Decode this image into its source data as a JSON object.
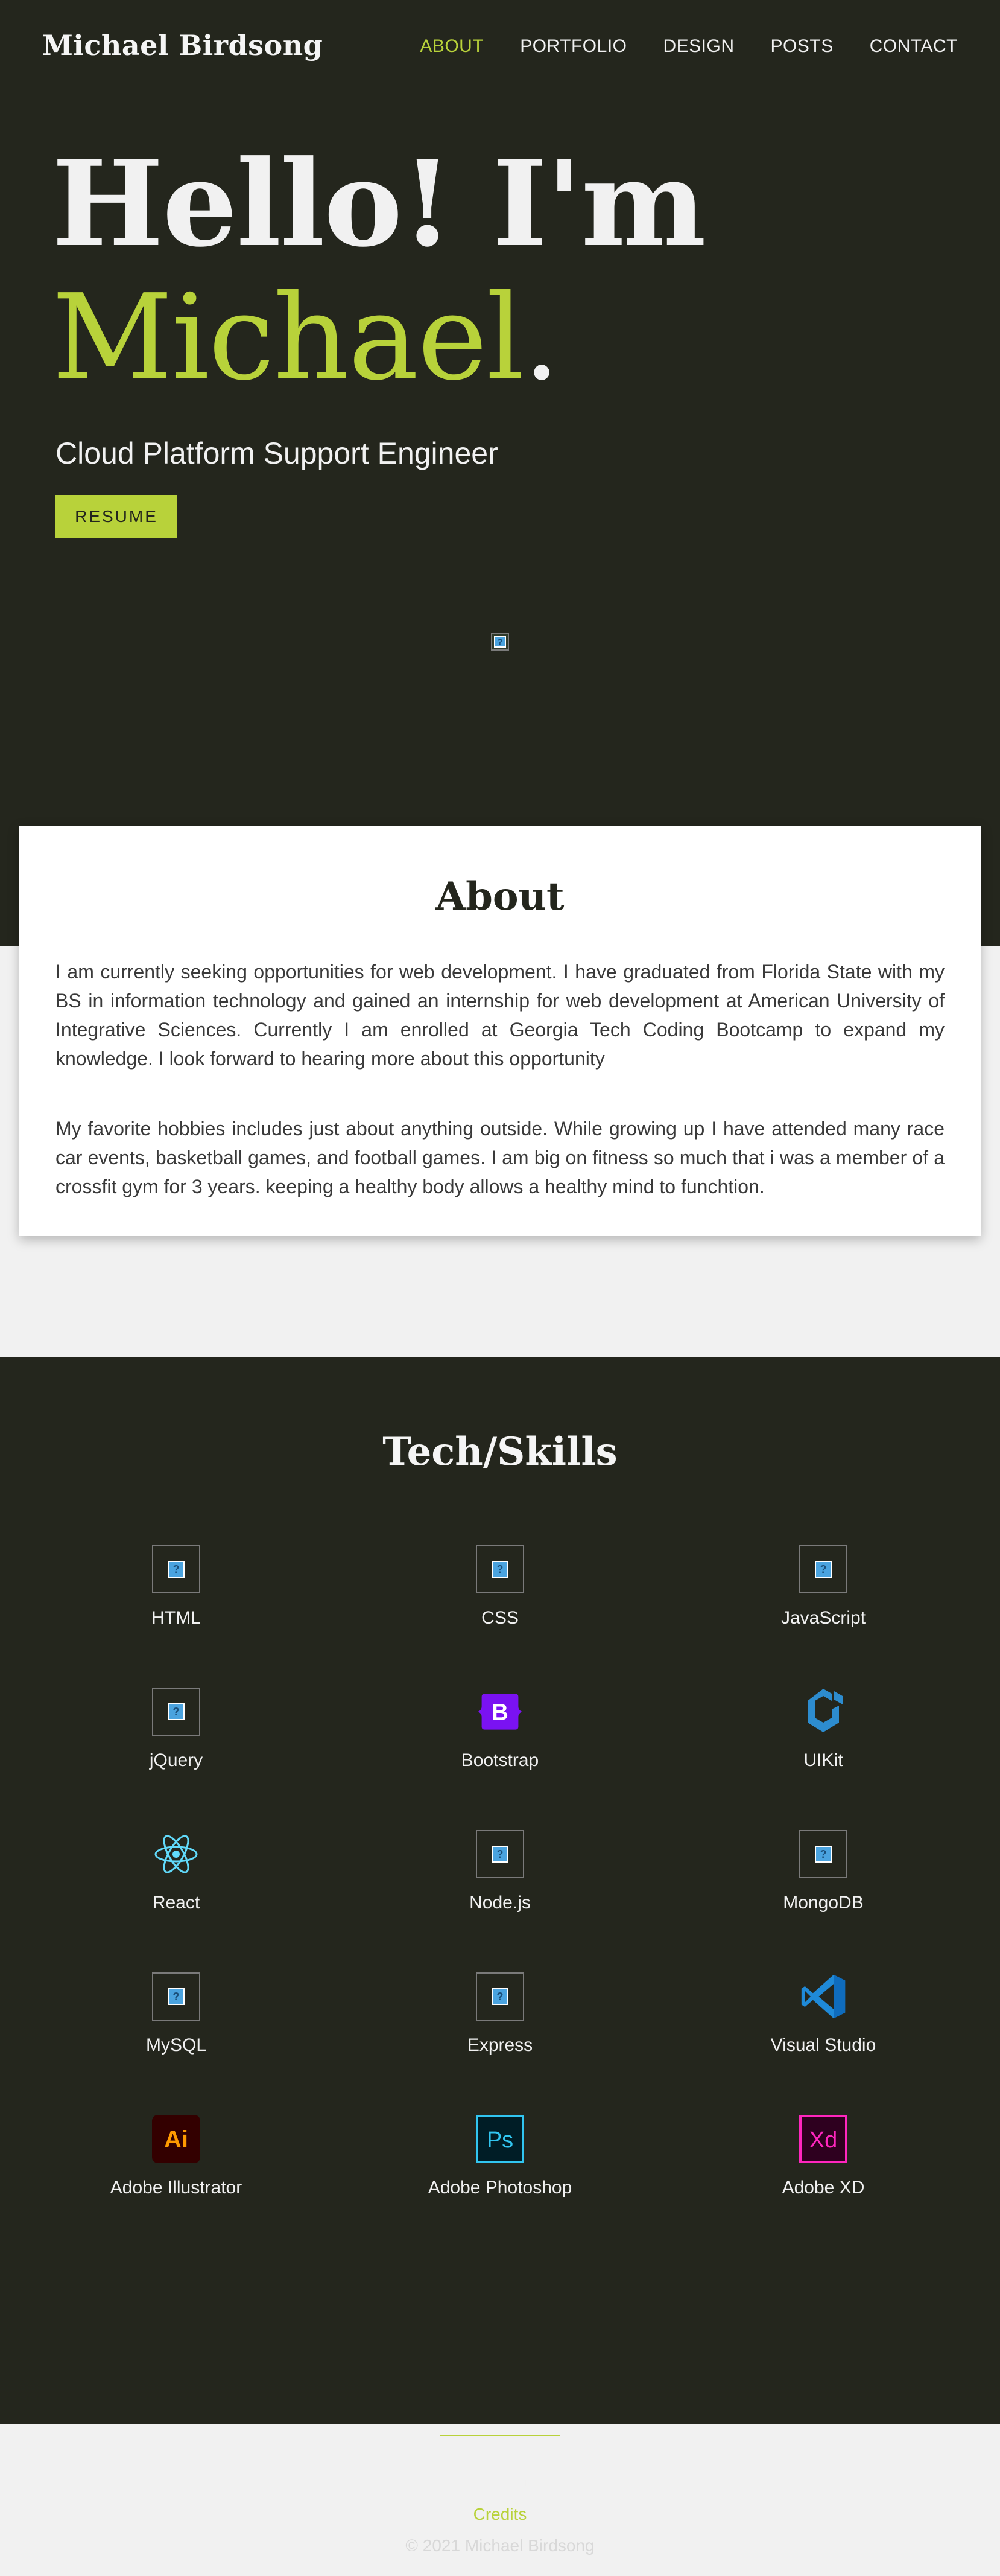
{
  "header": {
    "brand": "Michael Birdsong",
    "nav": [
      {
        "label": "ABOUT",
        "active": true
      },
      {
        "label": "PORTFOLIO",
        "active": false
      },
      {
        "label": "DESIGN",
        "active": false
      },
      {
        "label": "POSTS",
        "active": false
      },
      {
        "label": "CONTACT",
        "active": false
      }
    ]
  },
  "hero": {
    "line1": "Hello! I'm",
    "name": "Michael",
    "dot": ".",
    "subtitle": "Cloud Platform Support Engineer",
    "resume_label": "RESUME"
  },
  "about": {
    "title": "About",
    "paragraph1": "I am currently seeking opportunities for web development. I have graduated from Florida State with my BS in information technology and gained an internship for web development at American University of Integrative Sciences. Currently I am enrolled at Georgia Tech Coding Bootcamp to expand my knowledge. I look forward to hearing more about this opportunity",
    "paragraph2": "My favorite hobbies includes just about anything outside. While growing up I have attended many race car events, basketball games, and football games. I am big on fitness so much that i was a member of a crossfit gym for 3 years. keeping a healthy body allows a healthy mind to funchtion."
  },
  "skills": {
    "title": "Tech/Skills",
    "items": [
      {
        "label": "HTML",
        "icon": "broken-image-icon"
      },
      {
        "label": "CSS",
        "icon": "broken-image-icon"
      },
      {
        "label": "JavaScript",
        "icon": "broken-image-icon"
      },
      {
        "label": "jQuery",
        "icon": "broken-image-icon"
      },
      {
        "label": "Bootstrap",
        "icon": "bootstrap-icon"
      },
      {
        "label": "UIKit",
        "icon": "uikit-icon"
      },
      {
        "label": "React",
        "icon": "react-icon"
      },
      {
        "label": "Node.js",
        "icon": "broken-image-icon"
      },
      {
        "label": "MongoDB",
        "icon": "broken-image-icon"
      },
      {
        "label": "MySQL",
        "icon": "broken-image-icon"
      },
      {
        "label": "Express",
        "icon": "broken-image-icon"
      },
      {
        "label": "Visual Studio",
        "icon": "vscode-icon"
      },
      {
        "label": "Adobe Illustrator",
        "icon": "illustrator-icon"
      },
      {
        "label": "Adobe Photoshop",
        "icon": "photoshop-icon"
      },
      {
        "label": "Adobe XD",
        "icon": "xd-icon"
      }
    ]
  },
  "footer": {
    "icons": [
      "github-icon",
      "linkedin-icon"
    ],
    "credits": "Credits",
    "copyright": "© 2021 Michael Birdsong"
  },
  "colors": {
    "background_dark": "#24261d",
    "accent": "#b8d23a",
    "light": "#f1f1f1"
  }
}
